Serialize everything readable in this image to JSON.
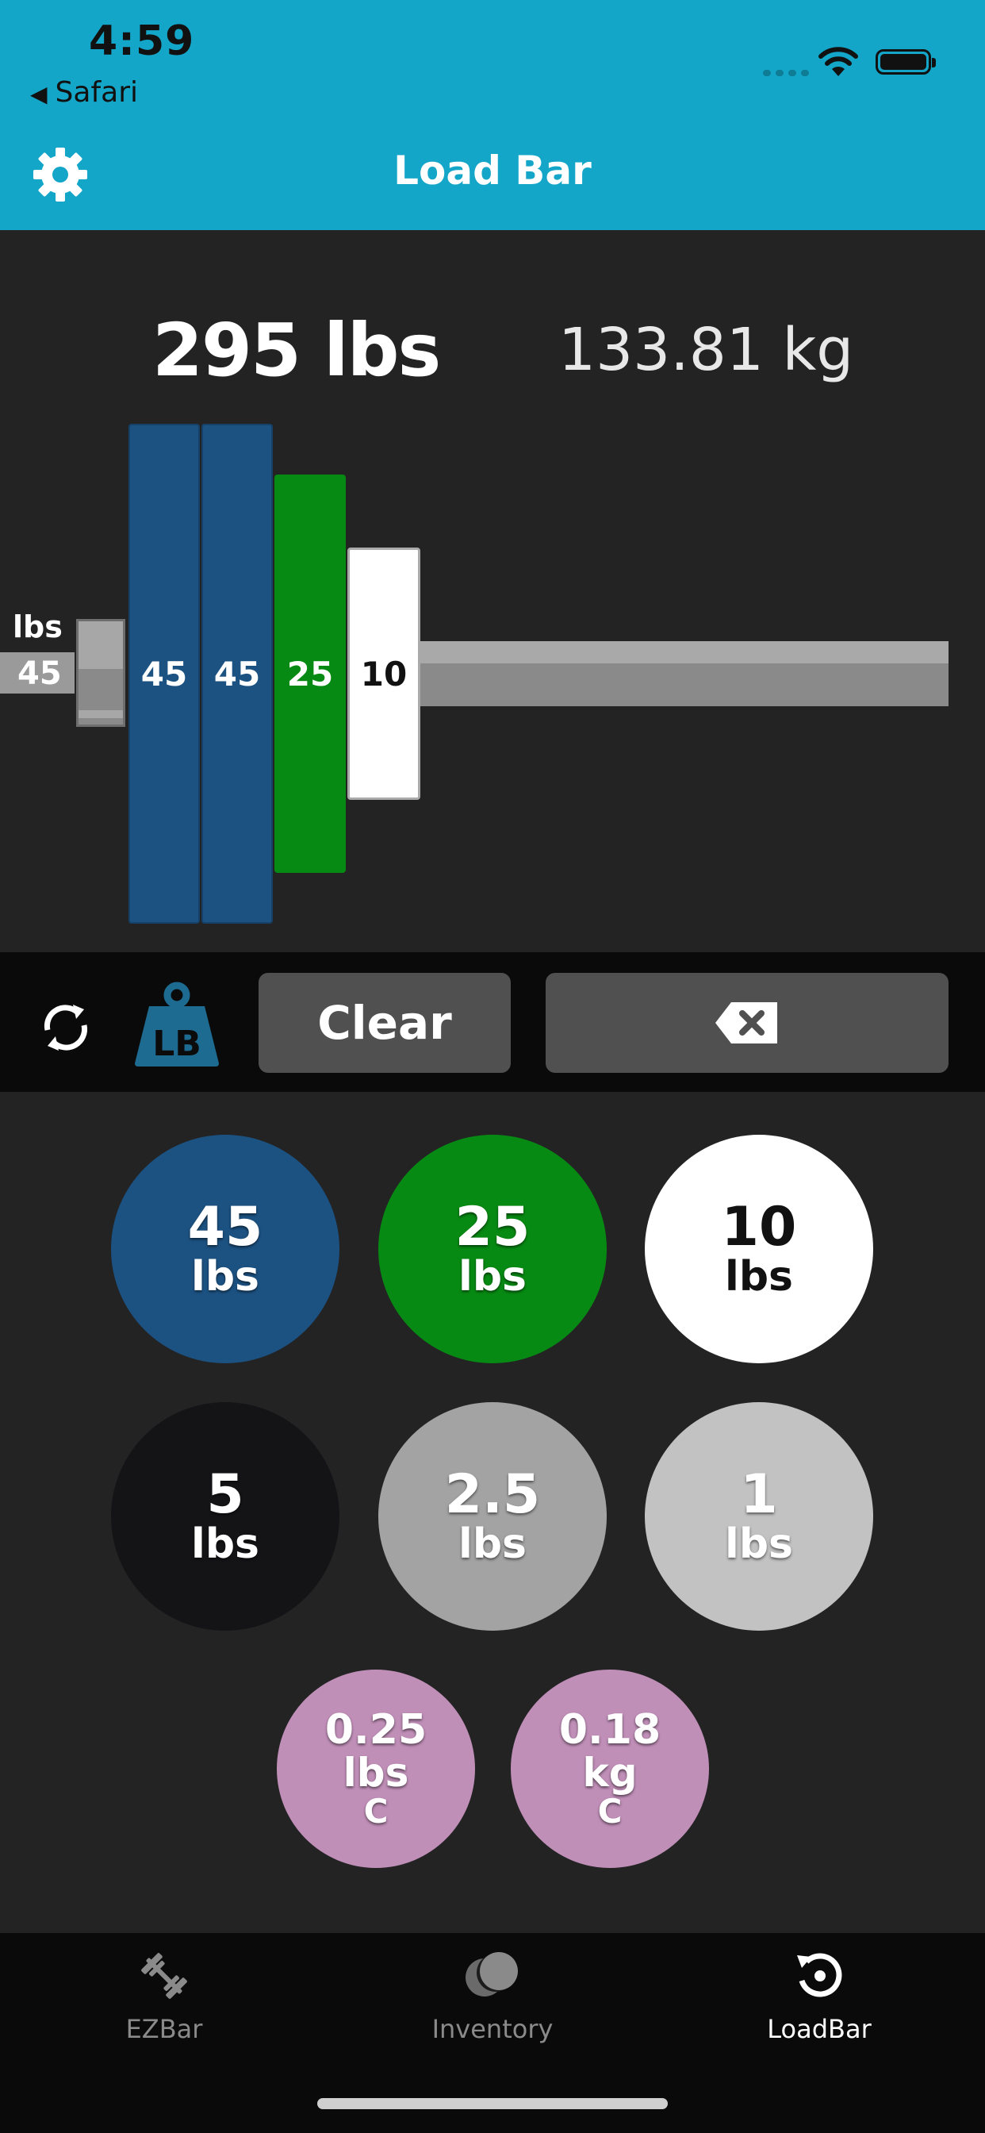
{
  "status_bar": {
    "time": "4:59",
    "back_app": "Safari"
  },
  "header": {
    "title": "Load Bar"
  },
  "summary": {
    "total_lbs": "295 lbs",
    "total_kg": "133.81 kg"
  },
  "bar": {
    "unit_label": "lbs",
    "bar_weight": "45",
    "loaded_plates": [
      {
        "label": "45",
        "color": "#1c5282"
      },
      {
        "label": "45",
        "color": "#1c5282"
      },
      {
        "label": "25",
        "color": "#078a13"
      },
      {
        "label": "10",
        "color": "#ffffff"
      }
    ]
  },
  "controls": {
    "refresh_icon": "refresh-icon",
    "unit_toggle_text": "LB",
    "clear_label": "Clear",
    "backspace_icon": "backspace-icon"
  },
  "plate_buttons": [
    {
      "value": "45",
      "unit": "lbs",
      "color": "#1c5282"
    },
    {
      "value": "25",
      "unit": "lbs",
      "color": "#078a13"
    },
    {
      "value": "10",
      "unit": "lbs",
      "color": "#ffffff"
    },
    {
      "value": "5",
      "unit": "lbs",
      "color": "#141416"
    },
    {
      "value": "2.5",
      "unit": "lbs",
      "color": "#a3a3a3"
    },
    {
      "value": "1",
      "unit": "lbs",
      "color": "#c2c2c2"
    },
    {
      "value": "0.25",
      "unit": "lbs",
      "flag": "C",
      "color": "#c08fb8"
    },
    {
      "value": "0.18",
      "unit": "kg",
      "flag": "C",
      "color": "#c08fb8"
    }
  ],
  "tabs": [
    {
      "label": "EZBar",
      "icon": "barbell-icon",
      "active": false
    },
    {
      "label": "Inventory",
      "icon": "plates-icon",
      "active": false
    },
    {
      "label": "LoadBar",
      "icon": "loadbar-icon",
      "active": true
    }
  ],
  "colors": {
    "header_bg": "#14a6c8",
    "background": "#232324",
    "button_bg": "#505050"
  }
}
